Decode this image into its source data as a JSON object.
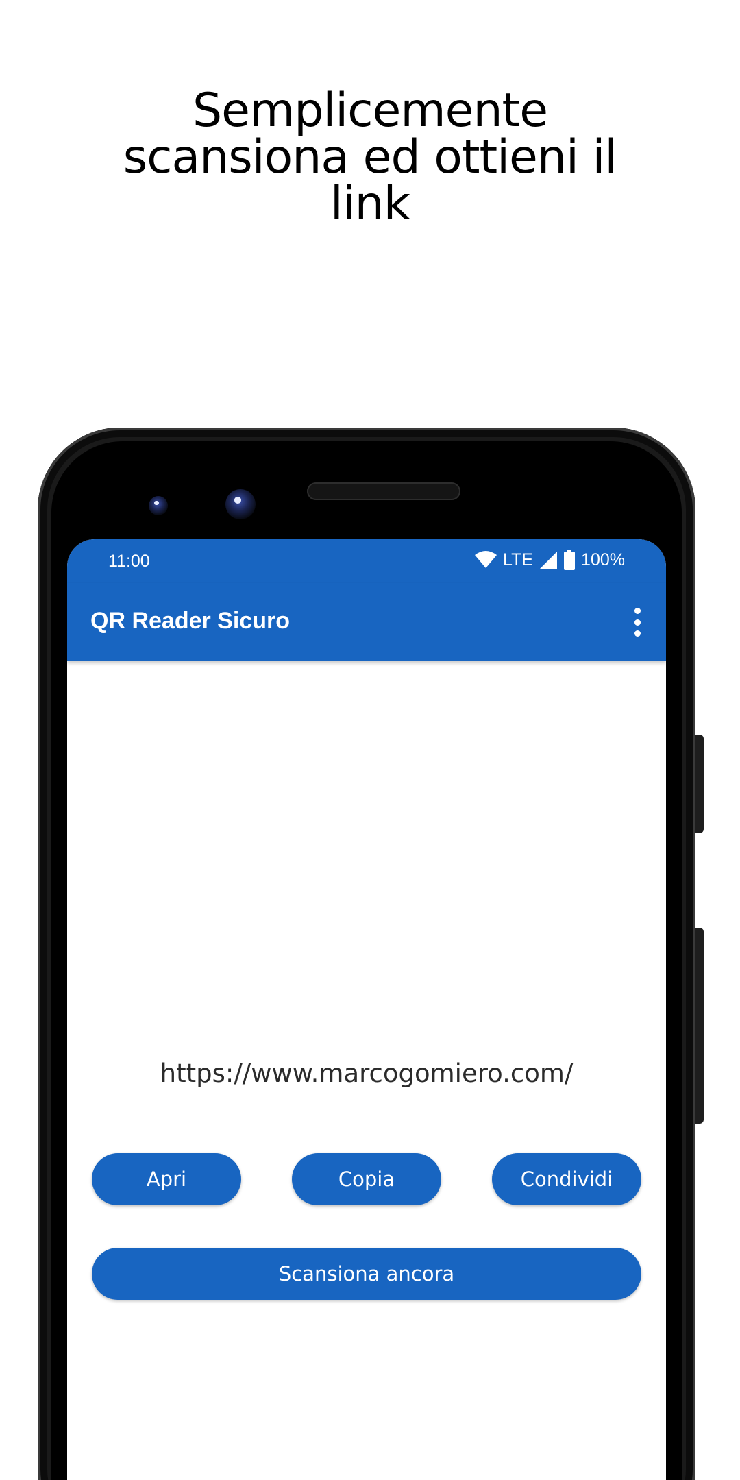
{
  "headline": {
    "line1": "Semplicemente",
    "line2": "scansiona ed ottieni il",
    "line3": "link"
  },
  "statusbar": {
    "time": "11:00",
    "network": "LTE",
    "battery": "100%",
    "icons": [
      "wifi-icon",
      "signal-icon",
      "battery-icon"
    ]
  },
  "appbar": {
    "title": "QR Reader Sicuro",
    "menu_icon": "more-vert-icon"
  },
  "result": {
    "url": "https://www.marcogomiero.com/"
  },
  "actions": {
    "open_label": "Apri",
    "copy_label": "Copia",
    "share_label": "Condividi",
    "scan_again_label": "Scansiona ancora"
  },
  "colors": {
    "primary": "#1865c1",
    "on_primary": "#ffffff",
    "text": "#2b2b2b"
  }
}
